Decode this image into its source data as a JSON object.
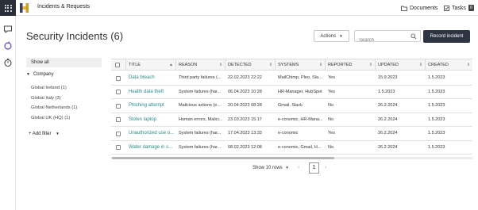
{
  "app": {
    "title": "Incidents & Requests"
  },
  "topnav": {
    "documents": "Documents",
    "tasks": "Tasks",
    "tasks_count": "0"
  },
  "header": {
    "title": "Security Incidents (6)",
    "actions_label": "Actions",
    "search_placeholder": "Search",
    "record_label": "Record incident"
  },
  "filters": {
    "show_all": "Show all",
    "company_label": "Company",
    "companies": [
      "Global Ireland (1)",
      "Global Italy (3)",
      "Global Netherlands (1)",
      "Global UK (HQ) (1)"
    ],
    "add_filter": "+ Add filter"
  },
  "table": {
    "columns": [
      "TITLE",
      "REASON",
      "DETECTED",
      "SYSTEMS",
      "REPORTED",
      "UPDATED",
      "CREATED"
    ],
    "rows": [
      {
        "title": "Data breach",
        "reason": "Third party failures (...",
        "detected": "22.02.2023 22:22",
        "systems": "MailChimp, Pleo, Sla...",
        "reported": "Yes",
        "updated": "15.9.2023",
        "created": "1.5.2023"
      },
      {
        "title": "Health data theft",
        "reason": "System failures (har...",
        "detected": "06.04.2023 10:28",
        "systems": "HR-Manager, HubSpot",
        "reported": "Yes",
        "updated": "1.5.2023",
        "created": "1.5.2023"
      },
      {
        "title": "Phishing attempt",
        "reason": "Malicious actions (e...",
        "detected": "20.04.2023 08:28",
        "systems": "Gmail, Slack",
        "reported": "No",
        "updated": "26.2.2024",
        "created": "1.5.2023"
      },
      {
        "title": "Stolen laptop",
        "reason": "Human errors, Malici...",
        "detected": "23.03.2023 15:17",
        "systems": "e-conomic, HR-Mana...",
        "reported": "No",
        "updated": "26.2.2024",
        "created": "1.5.2023"
      },
      {
        "title": "Unauthorized use o...",
        "reason": "System failures (har...",
        "detected": "17.04.2023 13:33",
        "systems": "e-conomic",
        "reported": "Yes",
        "updated": "26.2.2024",
        "created": "1.5.2023"
      },
      {
        "title": "Water damage in s...",
        "reason": "System failures (har...",
        "detected": "08.02.2023 12:08",
        "systems": "e-conomic, Gmail, H...",
        "reported": "No",
        "updated": "26.2.2024",
        "created": "1.5.2023"
      }
    ]
  },
  "pagination": {
    "rows_label": "Show 10 rows",
    "current_page": "1"
  },
  "colors": {
    "link": "#2a8a8a",
    "primary_button": "#2e3442",
    "rail_dark": "#2a2f3a"
  }
}
